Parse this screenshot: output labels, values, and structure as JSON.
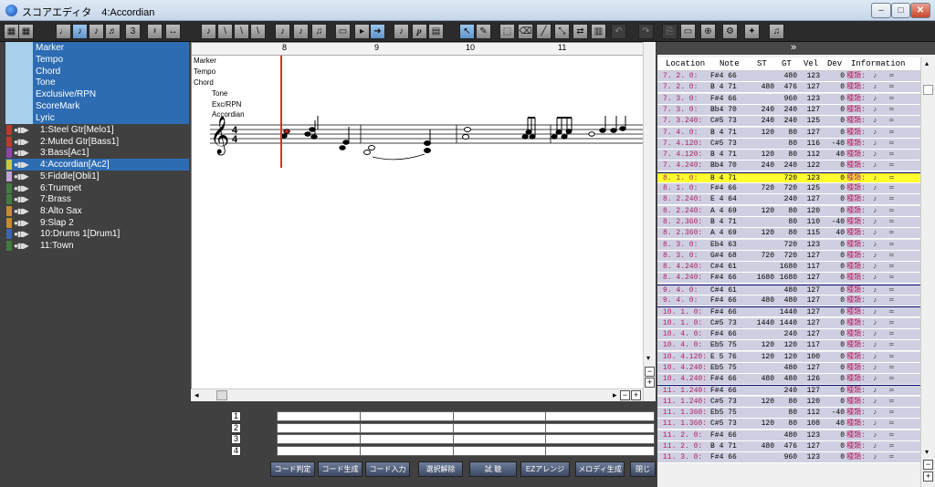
{
  "window": {
    "title": "スコアエディタ　4:Accordian",
    "minimize": "–",
    "maximize": "□",
    "close": "✕"
  },
  "toolbar": {
    "icons": [
      "grid-icon",
      "grid-icon",
      "quarter-note-icon",
      "eighth-note-icon",
      "eighth-note-icon",
      "sixteenth-note-icon",
      "triplet-icon",
      "rest-icon",
      "swap-icon",
      "note-entry-icon",
      "slash-icon",
      "slash-icon",
      "slash-icon",
      "note-icon",
      "note-icon",
      "chord-icon",
      "box-icon",
      "arrow-box-icon",
      "arrow-icon",
      "score-icon",
      "piano-icon",
      "page-icon",
      "pointer-icon",
      "pencil-icon",
      "select-icon",
      "eraser-icon",
      "pen-icon",
      "snap-icon",
      "flip-icon",
      "keyboard-icon",
      "undo-icon",
      "redo-icon",
      "copy-icon",
      "paste-icon",
      "zoom-icon",
      "settings-icon",
      "tools-icon",
      "sound-icon"
    ]
  },
  "left_panel": {
    "system_rows": [
      "Marker",
      "Tempo",
      "Chord",
      "Tone",
      "Exclusive/RPN",
      "ScoreMark",
      "Lyric"
    ],
    "tracks": [
      {
        "label": "1:Steel Gtr[Melo1]",
        "color": "#c0392b"
      },
      {
        "label": "2:Muted Gtr[Bass1]",
        "color": "#c0392b"
      },
      {
        "label": "3:Bass[Ac1]",
        "color": "#8e44ad"
      },
      {
        "label": "4:Accordian[Ac2]",
        "color": "#d4c437"
      },
      {
        "label": "5:Fiddle[Obli1]",
        "color": "#c2a4d6"
      },
      {
        "label": "6:Trumpet",
        "color": "#3f7d3f"
      },
      {
        "label": "7:Brass",
        "color": "#3f7d3f"
      },
      {
        "label": "8:Alto Sax",
        "color": "#c78a2f"
      },
      {
        "label": "9:Slap 2",
        "color": "#c78a2f"
      },
      {
        "label": "10:Drums 1[Drum1]",
        "color": "#3a66b0"
      },
      {
        "label": "11:Town",
        "color": "#3f7d3f"
      }
    ]
  },
  "score": {
    "ruler": [
      "8",
      "9",
      "10",
      "11"
    ],
    "labels": [
      "Marker",
      "Tempo",
      "Chord",
      "Tone",
      "Exc/RPN",
      "Accordian"
    ],
    "time_sig_top": "4",
    "time_sig_bottom": "4",
    "scroll_arrows": [
      "◂",
      "▸",
      "▴",
      "▾",
      "−",
      "+"
    ]
  },
  "chord_panel": {
    "rows": [
      "1",
      "2",
      "3",
      "4"
    ],
    "buttons": [
      "コード判定",
      "コード生成",
      "コード入力",
      "選択解除",
      "試 聴",
      "EZアレンジ",
      "メロディ生成",
      "閉じ"
    ]
  },
  "event_list": {
    "expand": "»",
    "columns": [
      "Location",
      "Note",
      "ST",
      "GT",
      "Vel",
      "Dev",
      "Information"
    ],
    "rows": [
      {
        "pos": "7. 2.   0:",
        "note": "F#4  66",
        "st": "",
        "gt": "480",
        "vel": "123",
        "dev": "0",
        "info": "種類:"
      },
      {
        "pos": "7. 2.   0:",
        "note": "B 4  71",
        "st": "480",
        "gt": "476",
        "vel": "127",
        "dev": "0",
        "info": "種類:"
      },
      {
        "pos": "7. 3.   0:",
        "note": "F#4  66",
        "st": "",
        "gt": "960",
        "vel": "123",
        "dev": "0",
        "info": "種類:"
      },
      {
        "pos": "7. 3.   0:",
        "note": "Bb4  70",
        "st": "240",
        "gt": "240",
        "vel": "127",
        "dev": "0",
        "info": "種類:"
      },
      {
        "pos": "7. 3.240:",
        "note": "C#5  73",
        "st": "240",
        "gt": "240",
        "vel": "125",
        "dev": "0",
        "info": "種類:"
      },
      {
        "pos": "7. 4.   0:",
        "note": "B 4  71",
        "st": "120",
        "gt": "80",
        "vel": "127",
        "dev": "0",
        "info": "種類:"
      },
      {
        "pos": "7. 4.120:",
        "note": "C#5  73",
        "st": "",
        "gt": "80",
        "vel": "116",
        "dev": "-40",
        "info": "種類:"
      },
      {
        "pos": "7. 4.120:",
        "note": "B 4  71",
        "st": "120",
        "gt": "80",
        "vel": "112",
        "dev": "40",
        "info": "種類:"
      },
      {
        "pos": "7. 4.240:",
        "note": "Bb4  70",
        "st": "240",
        "gt": "240",
        "vel": "122",
        "dev": "0",
        "info": "種類:"
      },
      {
        "pos": "8. 1.   0:",
        "note": "B 4  71",
        "st": "",
        "gt": "720",
        "vel": "123",
        "dev": "0",
        "info": "種類:",
        "hl": true,
        "bar": true
      },
      {
        "pos": "8. 1.   0:",
        "note": "F#4  66",
        "st": "720",
        "gt": "720",
        "vel": "125",
        "dev": "0",
        "info": "種類:"
      },
      {
        "pos": "8. 2.240:",
        "note": "E 4  64",
        "st": "",
        "gt": "240",
        "vel": "127",
        "dev": "0",
        "info": "種類:"
      },
      {
        "pos": "8. 2.240:",
        "note": "A 4  69",
        "st": "120",
        "gt": "80",
        "vel": "120",
        "dev": "0",
        "info": "種類:"
      },
      {
        "pos": "8. 2.360:",
        "note": "B 4  71",
        "st": "",
        "gt": "80",
        "vel": "110",
        "dev": "-40",
        "info": "種類:"
      },
      {
        "pos": "8. 2.360:",
        "note": "A 4  69",
        "st": "120",
        "gt": "80",
        "vel": "115",
        "dev": "40",
        "info": "種類:"
      },
      {
        "pos": "8. 3.   0:",
        "note": "Eb4  63",
        "st": "",
        "gt": "720",
        "vel": "123",
        "dev": "0",
        "info": "種類:"
      },
      {
        "pos": "8. 3.   0:",
        "note": "G#4  68",
        "st": "720",
        "gt": "720",
        "vel": "127",
        "dev": "0",
        "info": "種類:"
      },
      {
        "pos": "8. 4.240:",
        "note": "C#4  61",
        "st": "",
        "gt": "1680",
        "vel": "117",
        "dev": "0",
        "info": "種類:"
      },
      {
        "pos": "8. 4.240:",
        "note": "F#4  66",
        "st": "1680",
        "gt": "1680",
        "vel": "127",
        "dev": "0",
        "info": "種類:"
      },
      {
        "pos": "9. 4.   0:",
        "note": "C#4  61",
        "st": "",
        "gt": "480",
        "vel": "127",
        "dev": "0",
        "info": "種類:",
        "bar": true
      },
      {
        "pos": "9. 4.   0:",
        "note": "F#4  66",
        "st": "480",
        "gt": "480",
        "vel": "127",
        "dev": "0",
        "info": "種類:"
      },
      {
        "pos": "10. 1.   0:",
        "note": "F#4  66",
        "st": "",
        "gt": "1440",
        "vel": "127",
        "dev": "0",
        "info": "種類:",
        "bar": true
      },
      {
        "pos": "10. 1.   0:",
        "note": "C#5  73",
        "st": "1440",
        "gt": "1440",
        "vel": "127",
        "dev": "0",
        "info": "種類:"
      },
      {
        "pos": "10. 4.   0:",
        "note": "F#4  66",
        "st": "",
        "gt": "240",
        "vel": "127",
        "dev": "0",
        "info": "種類:"
      },
      {
        "pos": "10. 4.   0:",
        "note": "Eb5  75",
        "st": "120",
        "gt": "120",
        "vel": "117",
        "dev": "0",
        "info": "種類:"
      },
      {
        "pos": "10. 4.120:",
        "note": "E 5  76",
        "st": "120",
        "gt": "120",
        "vel": "100",
        "dev": "0",
        "info": "種類:"
      },
      {
        "pos": "10. 4.240:",
        "note": "Eb5  75",
        "st": "",
        "gt": "480",
        "vel": "127",
        "dev": "0",
        "info": "種類:"
      },
      {
        "pos": "10. 4.240:",
        "note": "F#4  66",
        "st": "480",
        "gt": "480",
        "vel": "126",
        "dev": "0",
        "info": "種類:"
      },
      {
        "pos": "11. 1.240:",
        "note": "F#4  66",
        "st": "",
        "gt": "240",
        "vel": "127",
        "dev": "0",
        "info": "種類:",
        "bar": true
      },
      {
        "pos": "11. 1.240:",
        "note": "C#5  73",
        "st": "120",
        "gt": "80",
        "vel": "120",
        "dev": "0",
        "info": "種類:"
      },
      {
        "pos": "11. 1.360:",
        "note": "Eb5  75",
        "st": "",
        "gt": "80",
        "vel": "112",
        "dev": "-40",
        "info": "種類:"
      },
      {
        "pos": "11. 1.360:",
        "note": "C#5  73",
        "st": "120",
        "gt": "80",
        "vel": "108",
        "dev": "40",
        "info": "種類:"
      },
      {
        "pos": "11. 2.   0:",
        "note": "F#4  66",
        "st": "",
        "gt": "480",
        "vel": "123",
        "dev": "0",
        "info": "種類:"
      },
      {
        "pos": "11. 2.   0:",
        "note": "B 4  71",
        "st": "480",
        "gt": "476",
        "vel": "127",
        "dev": "0",
        "info": "種類:"
      },
      {
        "pos": "11. 3.   0:",
        "note": "F#4  66",
        "st": "",
        "gt": "960",
        "vel": "123",
        "dev": "0",
        "info": "種類:"
      }
    ],
    "scroll_arrows": [
      "▴",
      "▾",
      "−",
      "+"
    ]
  }
}
